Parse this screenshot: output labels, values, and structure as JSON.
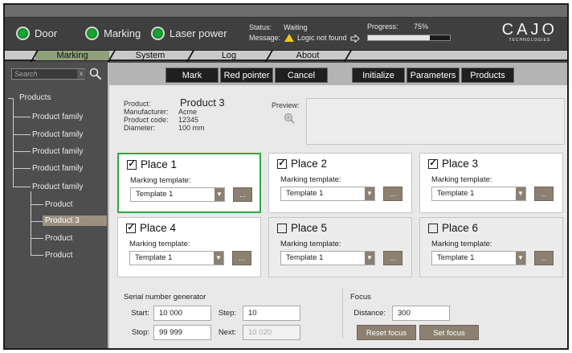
{
  "header": {
    "indicators": [
      {
        "label": "Door",
        "state_color": "#16a82e"
      },
      {
        "label": "Marking",
        "state_color": "#16a82e"
      },
      {
        "label": "Laser power",
        "state_color": "#16a82e"
      }
    ],
    "status_label": "Status:",
    "status_value": "Waiting",
    "message_label": "Message:",
    "message_value": "Logic not found",
    "progress_label": "Progress:",
    "progress_value": "75%",
    "progress_fraction": 0.75,
    "logo_main": "CAJO",
    "logo_sub": "TECHNOLOGIES"
  },
  "tabs": [
    {
      "label": "Marking",
      "active": true
    },
    {
      "label": "System",
      "active": false
    },
    {
      "label": "Log",
      "active": false
    },
    {
      "label": "About",
      "active": false
    }
  ],
  "sidebar": {
    "search_placeholder": "Search",
    "search_clear": "x",
    "tree": {
      "root": "Products",
      "items": [
        "Product family",
        "Product family",
        "Product family",
        "Product family",
        "Product family"
      ],
      "children": [
        "Product",
        "Product 3",
        "Product",
        "Product"
      ],
      "selected": "Product 3"
    }
  },
  "toolbar": {
    "mark": "Mark",
    "red_pointer": "Red pointer",
    "cancel": "Cancel",
    "initialize": "Initialize",
    "parameters": "Parameters",
    "products": "Products"
  },
  "product": {
    "product_label": "Product:",
    "product_name": "Product 3",
    "manufacturer_label": "Manufacturer:",
    "manufacturer": "Acme",
    "code_label": "Product code:",
    "code": "12345",
    "diameter_label": "Diameter:",
    "diameter": "100 mm",
    "preview_label": "Preview:"
  },
  "places": [
    {
      "title": "Place 1",
      "checked": "✓",
      "template_label": "Marking template:",
      "template": "Template 1",
      "more": "...",
      "selected": true
    },
    {
      "title": "Place 2",
      "checked": "✓",
      "template_label": "Marking template:",
      "template": "Template 1",
      "more": "..."
    },
    {
      "title": "Place 3",
      "checked": "✓",
      "template_label": "Marking template:",
      "template": "Template 1",
      "more": "..."
    },
    {
      "title": "Place 4",
      "checked": "✓",
      "template_label": "Marking template:",
      "template": "Template 1",
      "more": "..."
    },
    {
      "title": "Place 5",
      "checked": "",
      "template_label": "Marking template:",
      "template": "Template 1",
      "more": "..."
    },
    {
      "title": "Place 6",
      "checked": "",
      "template_label": "Marking template:",
      "template": "Template 1",
      "more": "..."
    }
  ],
  "serial": {
    "title": "Serial number generator",
    "start_label": "Start:",
    "start": "10 000",
    "step_label": "Step:",
    "step": "10",
    "stop_label": "Stop:",
    "stop": "99 999",
    "next_label": "Next:",
    "next": "10 020"
  },
  "focus": {
    "title": "Focus",
    "distance_label": "Distance:",
    "distance": "300",
    "reset": "Reset focus",
    "set": "Set focus"
  }
}
